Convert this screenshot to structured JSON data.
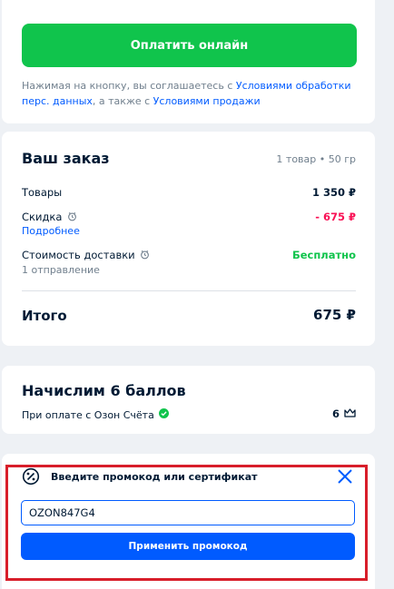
{
  "payment": {
    "button_label": "Оплатить онлайн",
    "legal_prefix": "Нажимая на кнопку, вы соглашаетесь с ",
    "legal_link1": "Условиями обработки перс. данных",
    "legal_middle": ", а также с ",
    "legal_link2": "Условиями продажи"
  },
  "order": {
    "title": "Ваш заказ",
    "meta": "1 товар • 50 гр",
    "goods_label": "Товары",
    "goods_value": "1 350 ₽",
    "discount_label": "Скидка",
    "discount_value": "- 675 ₽",
    "discount_link": "Подробнее",
    "delivery_label": "Стоимость доставки",
    "delivery_value": "Бесплатно",
    "delivery_note": "1 отправление",
    "total_label": "Итого",
    "total_value": "675 ₽",
    "colors": {
      "discount": "#f91155",
      "free": "#10c44c"
    }
  },
  "points": {
    "title": "Начислим 6 баллов",
    "note": "При оплате с Озон Счёта",
    "value": "6",
    "icons": [
      "check-circle-icon",
      "crown-icon"
    ]
  },
  "promo": {
    "title": "Введите промокод или сертификат",
    "input_value": "OZON847G4",
    "apply_label": "Применить промокод",
    "icons": [
      "percent-icon",
      "close-icon"
    ]
  },
  "colors": {
    "accent": "#005bff",
    "pay": "#10c44c",
    "highlight": "#d81e2a"
  }
}
